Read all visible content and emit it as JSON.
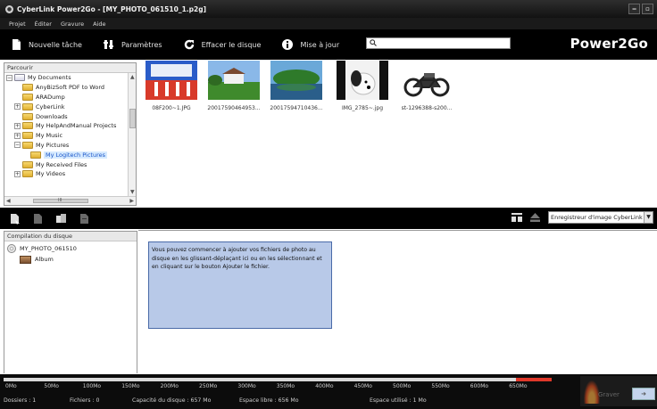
{
  "window": {
    "title": "CyberLink Power2Go - [MY_PHOTO_061510_1.p2g]",
    "minimize_label": "‒",
    "maximize_label": "▫"
  },
  "menu": [
    "Projet",
    "Éditer",
    "Gravure",
    "Aide"
  ],
  "toolbar": {
    "new_task": "Nouvelle tâche",
    "settings": "Paramètres",
    "erase_disc": "Effacer le disque",
    "update": "Mise à jour",
    "search_value": "",
    "brand": "Power2Go"
  },
  "browse": {
    "header": "Parcourir",
    "items": [
      {
        "label": "My Documents",
        "expander": "−",
        "icon": "doc-folder-icon"
      },
      {
        "label": "AnyBizSoft PDF to Word",
        "expander": "",
        "icon": "folder-icon"
      },
      {
        "label": "ARADump",
        "expander": "",
        "icon": "folder-icon"
      },
      {
        "label": "CyberLink",
        "expander": "+",
        "icon": "folder-icon"
      },
      {
        "label": "Downloads",
        "expander": "",
        "icon": "folder-icon"
      },
      {
        "label": "My HelpAndManual Projects",
        "expander": "+",
        "icon": "folder-icon"
      },
      {
        "label": "My Music",
        "expander": "+",
        "icon": "folder-icon"
      },
      {
        "label": "My Pictures",
        "expander": "−",
        "icon": "folder-icon"
      },
      {
        "label": "My Logitech Pictures",
        "expander": "",
        "icon": "folder-icon",
        "selected": true
      },
      {
        "label": "My Received Files",
        "expander": "",
        "icon": "folder-icon"
      },
      {
        "label": "My Videos",
        "expander": "+",
        "icon": "folder-icon"
      }
    ],
    "scroll_mid": "III"
  },
  "thumbnails": [
    {
      "caption": "08F200~1.JPG",
      "icon": "stadium-photo-icon"
    },
    {
      "caption": "20017590464953...",
      "icon": "landscape-photo-icon"
    },
    {
      "caption": "20017594710436...",
      "icon": "landscape-photo-icon"
    },
    {
      "caption": "IMG_2785~.jpg",
      "icon": "dog-photo-icon"
    },
    {
      "caption": "st-1296388-s200...",
      "icon": "motorcycle-photo-icon"
    }
  ],
  "compilation": {
    "recorder": "Enregistreur d'image CyberLink",
    "header": "Compilation du disque",
    "disc_name": "MY_PHOTO_061510",
    "album": "Album",
    "hint": "Vous pouvez commencer à ajouter vos fichiers de photo au disque en les glissant-déplaçant ici ou en les sélectionnant et en cliquant sur le bouton Ajouter le fichier."
  },
  "capacity": {
    "ticks": [
      "0Mo",
      "50Mo",
      "100Mo",
      "150Mo",
      "200Mo",
      "250Mo",
      "300Mo",
      "350Mo",
      "400Mo",
      "450Mo",
      "500Mo",
      "550Mo",
      "600Mo",
      "650Mo"
    ],
    "used_fraction": 0.0015,
    "folders": "Dossiers : 1",
    "files": "Fichiers : 0",
    "disc_capacity": "Capacité du disque : 657 Mo",
    "free_space": "Espace libre : 656 Mo",
    "used_space": "Espace utilisé : 1 Mo",
    "burn_label": "Graver"
  },
  "colors": {
    "accent_red": "#e0382a",
    "hint_bg": "#b8c9e8",
    "toolbar_bg": "#000000"
  }
}
